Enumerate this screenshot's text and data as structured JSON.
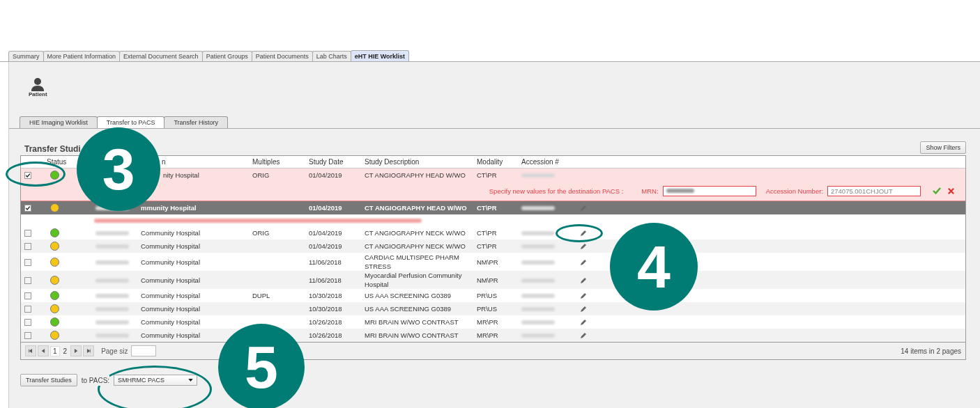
{
  "top_tabs": [
    {
      "label": "Summary",
      "selected": false
    },
    {
      "label": "More Patient Information",
      "selected": false
    },
    {
      "label": "External Document Search",
      "selected": false
    },
    {
      "label": "Patient Groups",
      "selected": false
    },
    {
      "label": "Patient Documents",
      "selected": false
    },
    {
      "label": "Lab Charts",
      "selected": false
    },
    {
      "label": "eHT HIE Worklist",
      "selected": true
    }
  ],
  "patient_label": "Patient",
  "sub_tabs": [
    {
      "label": "HIE Imaging Worklist",
      "selected": false
    },
    {
      "label": "Transfer to PACS",
      "selected": true
    },
    {
      "label": "Transfer History",
      "selected": false
    }
  ],
  "section_title": "Transfer Studi",
  "show_filters": "Show Filters",
  "columns": [
    {
      "label": "Status"
    },
    {
      "label": "n"
    },
    {
      "label": "Multiples"
    },
    {
      "label": "Study Date"
    },
    {
      "label": "Study Description"
    },
    {
      "label": "Modality"
    },
    {
      "label": "Accession #"
    }
  ],
  "rows": [
    {
      "kind": "editing",
      "checked": true,
      "color": "#5cc21e",
      "institution": "nity Hospital",
      "multiples": "ORIG",
      "study_date": "01/04/2019",
      "description": "CT ANGIOGRAPHY HEAD W/WO",
      "modality": "CT\\PR",
      "editable": false,
      "modified_notice": false
    },
    {
      "kind": "selected",
      "checked": true,
      "color": "#f5c518",
      "institution": "mmunity Hospital",
      "study_date": "01/04/2019",
      "description": "CT ANGIOGRAPHY HEAD W/WO",
      "modality": "CT\\PR",
      "editable": true,
      "modified_notice": true
    },
    {
      "kind": "normal",
      "checked": false,
      "color": "#5cc21e",
      "institution": "Community Hospital",
      "multiples": "ORIG",
      "study_date": "01/04/2019",
      "description": "CT ANGIOGRAPHY NECK W/WO",
      "modality": "CT\\PR",
      "editable": true,
      "modified_notice": false
    },
    {
      "kind": "normal",
      "checked": false,
      "color": "#f5c518",
      "institution": "Community Hospital",
      "study_date": "01/04/2019",
      "description": "CT ANGIOGRAPHY NECK W/WO",
      "modality": "CT\\PR",
      "editable": true,
      "modified_notice": false
    },
    {
      "kind": "normal",
      "checked": false,
      "color": "#f5c518",
      "institution": "Community Hospital",
      "study_date": "11/06/2018",
      "description": "CARDIAC MULTISPEC PHARM STRESS",
      "modality": "NM\\PR",
      "editable": true,
      "modified_notice": false
    },
    {
      "kind": "normal",
      "checked": false,
      "color": "#f5c518",
      "institution": "Community Hospital",
      "study_date": "11/06/2018",
      "description": "Myocardial Perfusion Community Hospital",
      "modality": "NM\\PR",
      "editable": true,
      "modified_notice": false
    },
    {
      "kind": "normal",
      "checked": false,
      "color": "#5cc21e",
      "institution": "Community Hospital",
      "multiples": "DUPL",
      "study_date": "10/30/2018",
      "description": "US AAA SCREENING G0389",
      "modality": "PR\\US",
      "editable": true,
      "modified_notice": false
    },
    {
      "kind": "normal",
      "checked": false,
      "color": "#f5c518",
      "institution": "Community Hospital",
      "study_date": "10/30/2018",
      "description": "US AAA SCREENING G0389",
      "modality": "PR\\US",
      "editable": true,
      "modified_notice": false
    },
    {
      "kind": "normal",
      "checked": false,
      "color": "#5cc21e",
      "institution": "Community Hospital",
      "study_date": "10/26/2018",
      "description": "MRI BRAIN W/WO CONTRAST",
      "modality": "MR\\PR",
      "editable": true,
      "modified_notice": false
    },
    {
      "kind": "normal",
      "checked": false,
      "color": "#f5c518",
      "institution": "Community Hospital",
      "study_date": "10/26/2018",
      "description": "MRI BRAIN W/WO CONTRAST",
      "modality": "MR\\PR",
      "editable": true,
      "modified_notice": false
    }
  ],
  "edit_form": {
    "prompt": "Specify new values for the destination PACS :",
    "mrn_label": "MRN:",
    "accession_label": "Accession Number:",
    "accession_value": "274075.001CHJOUT"
  },
  "pager": {
    "pages": [
      {
        "label": "1",
        "selected": true
      },
      {
        "label": "2",
        "selected": false
      }
    ],
    "page_size_label": "Page siz",
    "summary": "14 items in 2 pages"
  },
  "footer": {
    "transfer_button": "Transfer Studies",
    "pacs_label": "to PACS:",
    "pacs_value": "SMHRMC PACS"
  },
  "annotations": [
    {
      "label": "3"
    },
    {
      "label": "4"
    },
    {
      "label": "5"
    }
  ]
}
